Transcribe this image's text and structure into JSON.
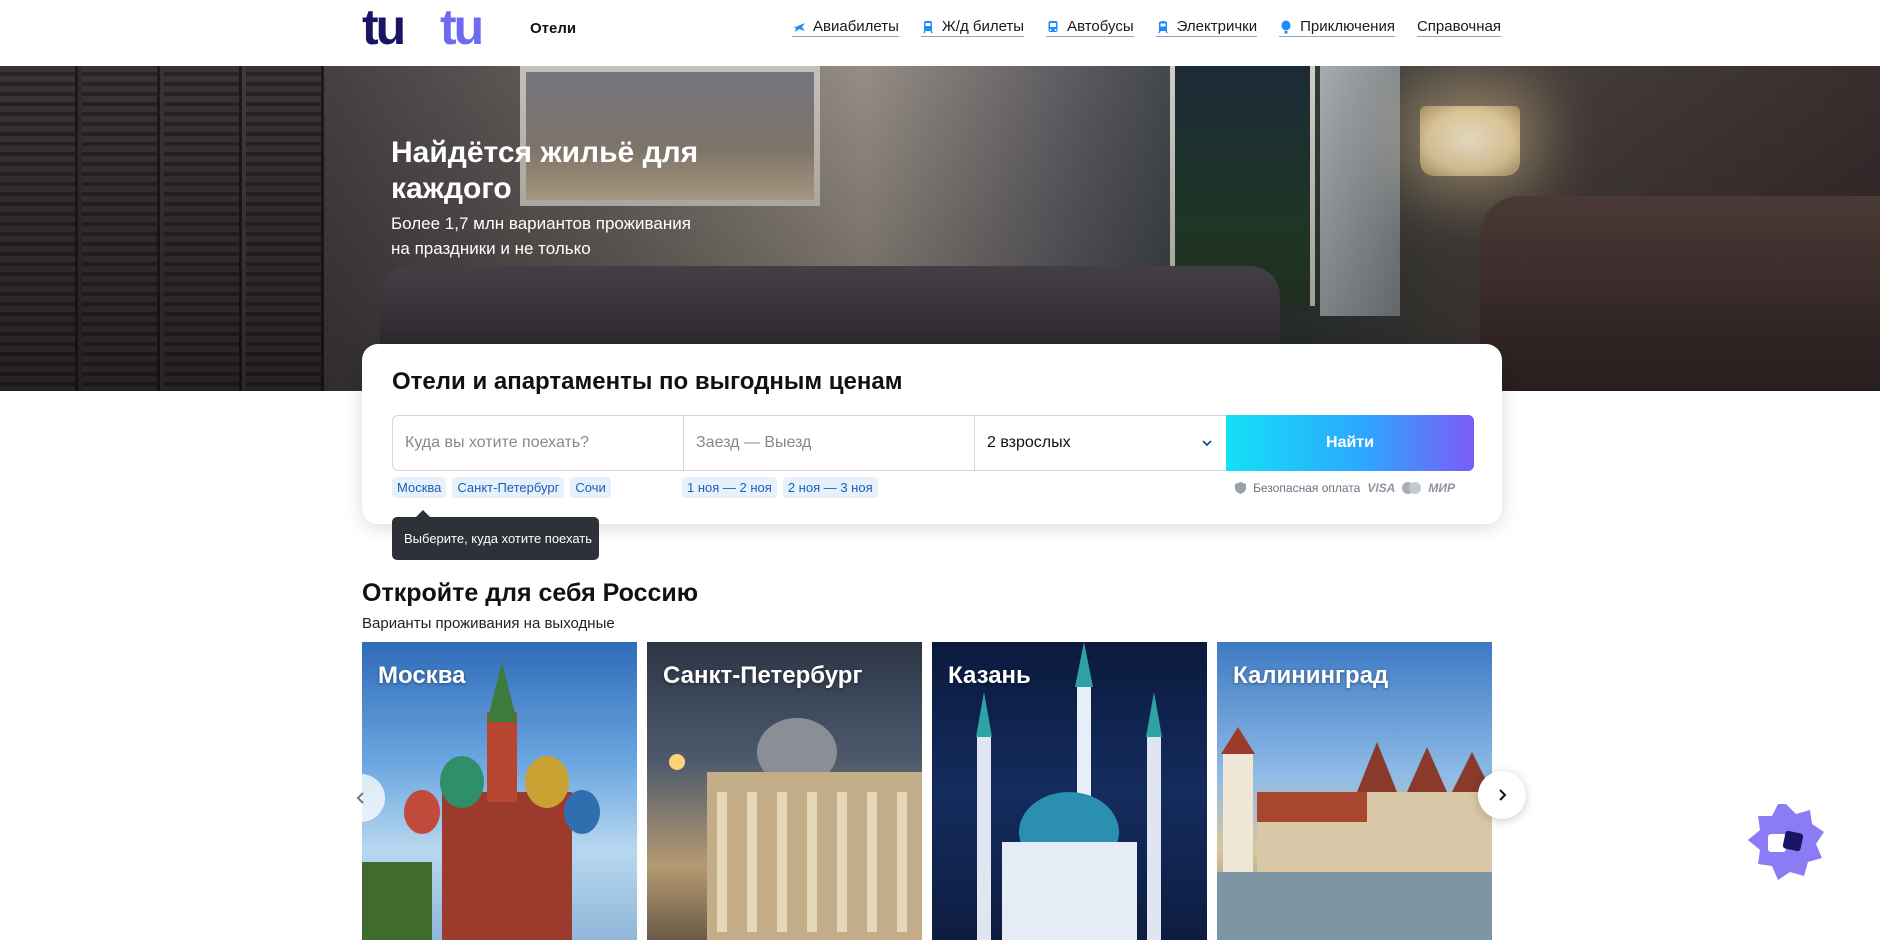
{
  "header": {
    "logo_text": "tutu",
    "logo_sub": "Отели",
    "nav": [
      {
        "label": "Авиабилеты",
        "icon": "plane-icon"
      },
      {
        "label": "Ж/д билеты",
        "icon": "train-icon"
      },
      {
        "label": "Автобусы",
        "icon": "bus-icon"
      },
      {
        "label": "Электрички",
        "icon": "commuter-train-icon"
      },
      {
        "label": "Приключения",
        "icon": "balloon-icon"
      },
      {
        "label": "Справочная",
        "icon": ""
      }
    ]
  },
  "hero": {
    "title": "Найдётся жильё для каждого",
    "subtitle": "Более 1,7 млн вариантов проживания на праздники и не только"
  },
  "search": {
    "title": "Отели и апартаменты по выгодным ценам",
    "destination_placeholder": "Куда вы хотите поехать?",
    "dates_placeholder": "Заезд — Выезд",
    "guests_value": "2 взрослых",
    "button_label": "Найти",
    "city_chips": [
      "Москва",
      "Санкт-Петербург",
      "Сочи"
    ],
    "date_chips": [
      "1 ноя — 2 ноя",
      "2 ноя — 3 ноя"
    ],
    "secure_label": "Безопасная оплата",
    "payment_visa": "VISA",
    "payment_mir": "МИР",
    "tooltip": "Выберите, куда хотите поехать"
  },
  "destinations": {
    "title": "Откройте для себя Россию",
    "subtitle": "Варианты проживания на выходные",
    "cities": [
      "Москва",
      "Санкт-Петербург",
      "Казань",
      "Калининград"
    ]
  },
  "colors": {
    "brand": "#1a1464",
    "brand_accent": "#6e6bf2",
    "button_gradient_start": "#13e1f5",
    "button_gradient_end": "#7b5cf6",
    "chip_bg": "#e6f1fb",
    "chip_text": "#1b5fb5",
    "assistant": "#8b7cf6"
  }
}
